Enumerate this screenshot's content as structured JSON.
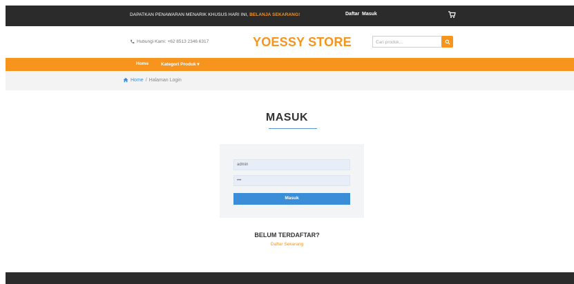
{
  "topbar": {
    "promo_text": "DAPATKAN PENAWARAN MENARIK KHUSUS HARI INI,",
    "promo_highlight": "BELANJA SEKARANG!",
    "daftar": "Daftar",
    "masuk": "Masuk"
  },
  "header": {
    "phone_label": "Hubungi Kami: +62 8513 2346 6317",
    "logo": "YOESSY STORE",
    "search_placeholder": "Cari produk..."
  },
  "nav": {
    "items": [
      {
        "label": "Home"
      },
      {
        "label": "Kategori Produk ▾"
      }
    ]
  },
  "breadcrumb": {
    "home": "Home",
    "separator": "/",
    "current": "Halaman Login"
  },
  "login": {
    "title": "MASUK",
    "username_value": "admin",
    "password_value": "•••",
    "button": "Masuk"
  },
  "register": {
    "title": "BELUM TERDAFTAR?",
    "link": "Daftar Sekarang"
  },
  "colors": {
    "accent": "#f7941d",
    "topbar": "#2b2b2b",
    "primary": "#3a8dd6"
  }
}
